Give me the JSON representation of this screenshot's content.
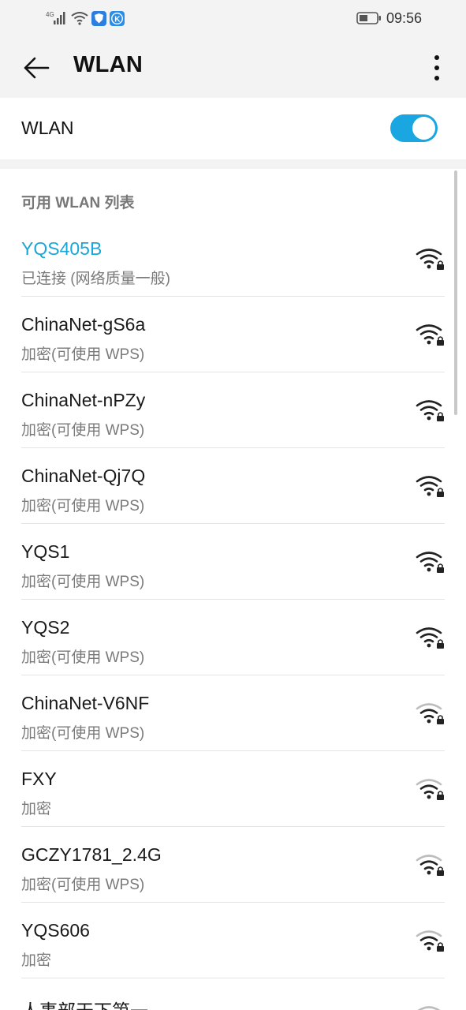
{
  "status_bar": {
    "network_type": "4G",
    "time": "09:56",
    "app_icon_1": "shield-app-icon",
    "app_icon_2": "k-app-icon",
    "k_letter": "K"
  },
  "header": {
    "title": "WLAN",
    "back_icon": "back-arrow-icon",
    "more_icon": "more-vertical-icon"
  },
  "wlan_toggle": {
    "label": "WLAN",
    "enabled": true,
    "accent_color": "#1aa6e0"
  },
  "networks_section": {
    "title": "可用 WLAN 列表",
    "items": [
      {
        "name": "YQS405B",
        "status": "已连接 (网络质量一般)",
        "connected": true,
        "signal": "strong",
        "secured": true
      },
      {
        "name": "ChinaNet-gS6a",
        "status": "加密(可使用 WPS)",
        "connected": false,
        "signal": "strong",
        "secured": true
      },
      {
        "name": "ChinaNet-nPZy",
        "status": "加密(可使用 WPS)",
        "connected": false,
        "signal": "strong",
        "secured": true
      },
      {
        "name": "ChinaNet-Qj7Q",
        "status": "加密(可使用 WPS)",
        "connected": false,
        "signal": "strong",
        "secured": true
      },
      {
        "name": "YQS1",
        "status": "加密(可使用 WPS)",
        "connected": false,
        "signal": "strong",
        "secured": true
      },
      {
        "name": "YQS2",
        "status": "加密(可使用 WPS)",
        "connected": false,
        "signal": "strong",
        "secured": true
      },
      {
        "name": "ChinaNet-V6NF",
        "status": "加密(可使用 WPS)",
        "connected": false,
        "signal": "weak",
        "secured": true
      },
      {
        "name": "FXY",
        "status": "加密",
        "connected": false,
        "signal": "weak",
        "secured": true
      },
      {
        "name": "GCZY1781_2.4G",
        "status": "加密(可使用 WPS)",
        "connected": false,
        "signal": "weak",
        "secured": true
      },
      {
        "name": "YQS606",
        "status": "加密",
        "connected": false,
        "signal": "weak",
        "secured": true
      },
      {
        "name": "人事部天下第一",
        "status": "",
        "connected": false,
        "signal": "weak",
        "secured": true
      }
    ]
  }
}
